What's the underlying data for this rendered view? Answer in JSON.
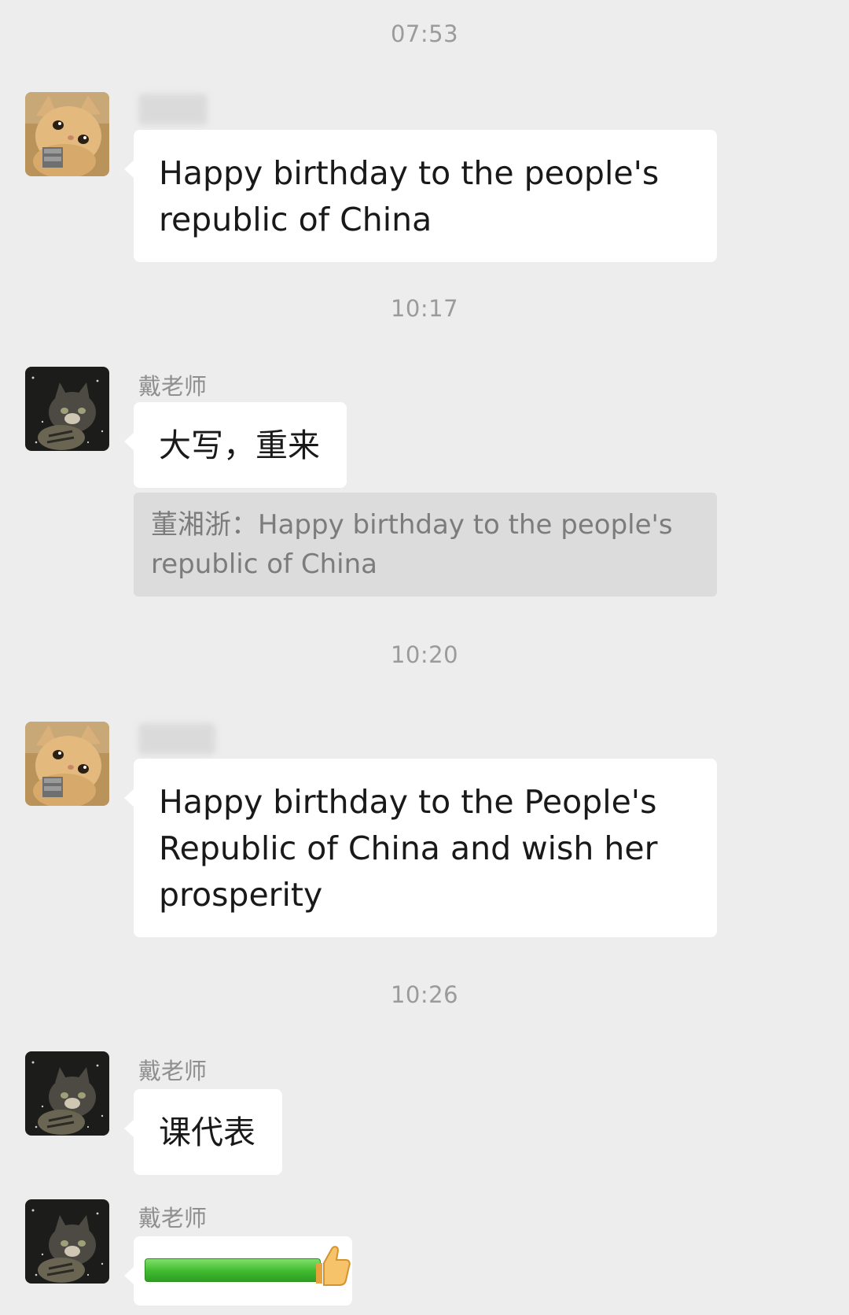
{
  "messages": [
    {
      "time": "07:53",
      "sender": "",
      "text": "Happy birthday to the people's republic of China"
    },
    {
      "time": "10:17",
      "sender": "戴老师",
      "text": "大写，重来",
      "quote": "董湘浙：Happy birthday to the people's republic of China"
    },
    {
      "time": "10:20",
      "sender": "",
      "text": "Happy birthday to the People's Republic of China and wish her prosperity"
    },
    {
      "time": "10:26",
      "sender": "戴老师",
      "text": "课代表"
    },
    {
      "sender": "戴老师",
      "sticker": "thumbs-up-icon"
    }
  ],
  "colors": {
    "background": "#ededed",
    "bubble": "#ffffff",
    "quote_background": "#dcdcdc",
    "timestamp": "#9b9b9b",
    "sender_name": "#8f8f8f"
  }
}
